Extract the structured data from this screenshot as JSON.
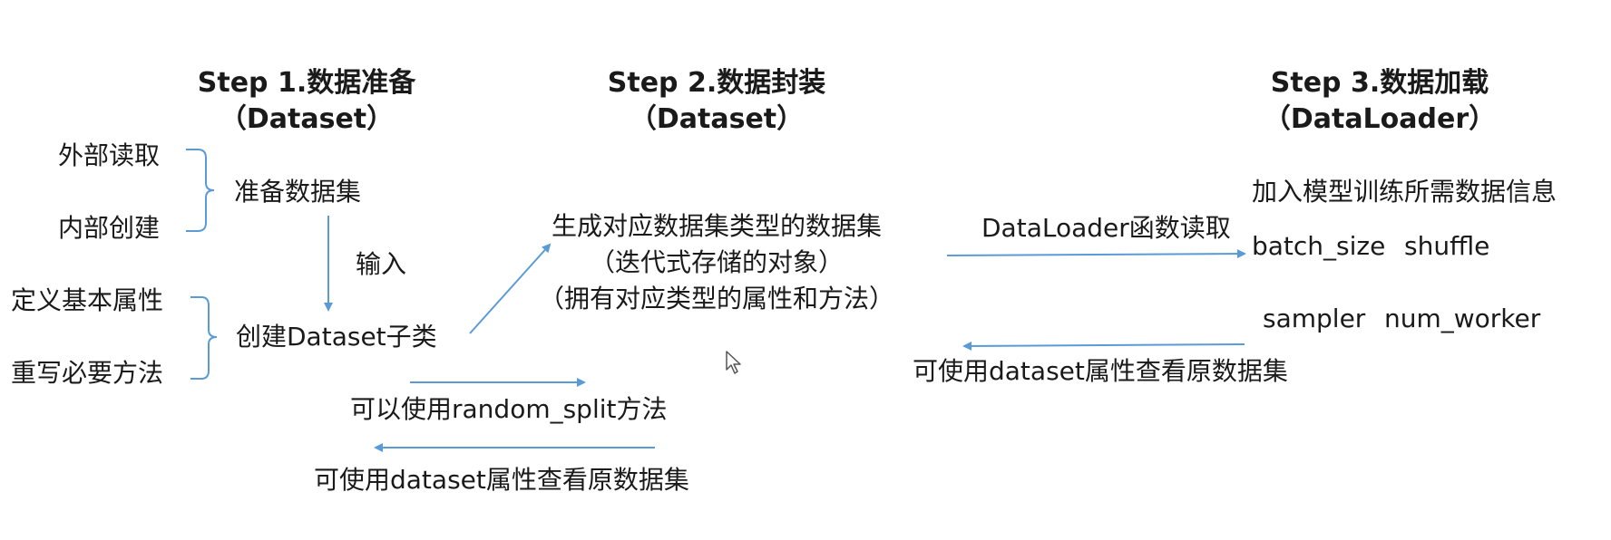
{
  "steps": [
    {
      "title": "Step 1.数据准备",
      "sub": "（Dataset）"
    },
    {
      "title": "Step 2.数据封装",
      "sub": "（Dataset）"
    },
    {
      "title": "Step 3.数据加载",
      "sub": "（DataLoader）"
    }
  ],
  "step1": {
    "external_read": "外部读取",
    "internal_create": "内部创建",
    "prepare_dataset": "准备数据集",
    "input": "输入",
    "define_attrs": "定义基本属性",
    "override_methods": "重写必要方法",
    "create_subclass": "创建Dataset子类",
    "random_split": "可以使用random_split方法",
    "view_original": "可使用dataset属性查看原数据集"
  },
  "step2": {
    "line1": "生成对应数据集类型的数据集",
    "line2": "（迭代式存储的对象）",
    "line3": "（拥有对应类型的属性和方法）"
  },
  "step3": {
    "loader_read": "DataLoader函数读取",
    "add_info": "加入模型训练所需数据信息",
    "batch_size": "batch_size",
    "shuffle": "shuffle",
    "sampler": "sampler",
    "num_worker": "num_worker",
    "view_original": "可使用dataset属性查看原数据集"
  },
  "colors": {
    "arrow": "#5b9bd5",
    "text": "#1a1a1a"
  }
}
